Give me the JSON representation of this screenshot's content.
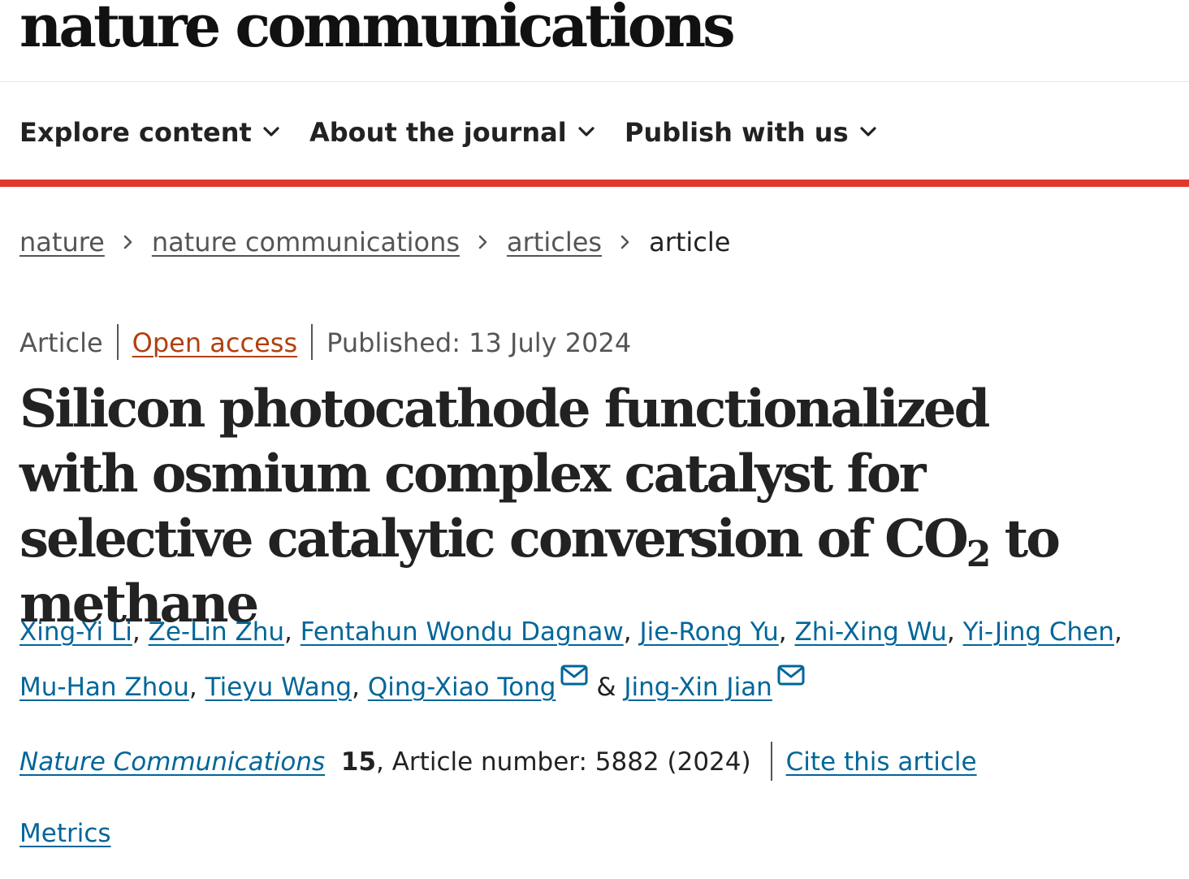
{
  "header": {
    "logo_text": "nature communications"
  },
  "nav": {
    "items": [
      {
        "label": "Explore content"
      },
      {
        "label": "About the journal"
      },
      {
        "label": "Publish with us"
      }
    ],
    "accent_color": "#e0392b"
  },
  "breadcrumb": {
    "items": [
      {
        "label": "nature"
      },
      {
        "label": "nature communications"
      },
      {
        "label": "articles"
      }
    ],
    "current": "article"
  },
  "article": {
    "type": "Article",
    "access": "Open access",
    "published": "Published: 13 July 2024",
    "title_before": "Silicon photocathode functionalized with osmium complex catalyst for selective catalytic conversion of CO",
    "title_subscript": "2",
    "title_after": " to methane",
    "authors": [
      "Xing-Yi Li",
      "Ze-Lin Zhu",
      "Fentahun Wondu Dagnaw",
      "Jie-Rong Yu",
      "Zhi-Xing Wu",
      "Yi-Jing Chen",
      "Mu-Han Zhou",
      "Tieyu Wang",
      "Qing-Xiao Tong",
      "Jing-Xin Jian"
    ],
    "authors_separator": ", ",
    "authors_last_separator": "&",
    "journal": "Nature Communications",
    "volume": "15",
    "article_number": ", Article number: 5882 (2024)",
    "cite_label": "Cite this article",
    "metrics_label": "Metrics"
  },
  "colors": {
    "link": "#006699",
    "open_access": "#b1400d",
    "text": "#222222",
    "muted": "#555555"
  }
}
